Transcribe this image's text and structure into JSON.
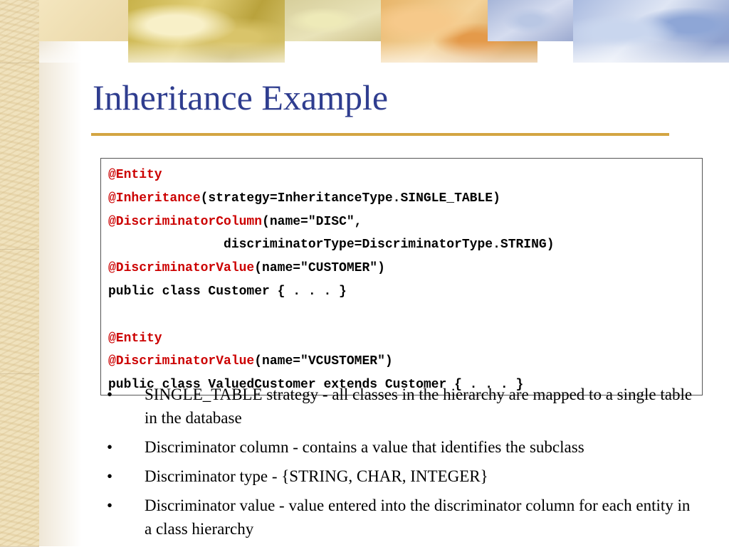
{
  "slide": {
    "title": "Inheritance Example",
    "code_lines": [
      {
        "ann": "@Entity",
        "rest": ""
      },
      {
        "ann": "@Inheritance",
        "rest": "(strategy=InheritanceType.SINGLE_TABLE)"
      },
      {
        "ann": "@DiscriminatorColumn",
        "rest": "(name=\"DISC\","
      },
      {
        "ann": "",
        "rest": "               discriminatorType=DiscriminatorType.STRING)"
      },
      {
        "ann": "@DiscriminatorValue",
        "rest": "(name=\"CUSTOMER\")"
      },
      {
        "ann": "",
        "rest": "public class Customer { . . . }"
      },
      {
        "ann": "",
        "rest": ""
      },
      {
        "ann": "@Entity",
        "rest": ""
      },
      {
        "ann": "@DiscriminatorValue",
        "rest": "(name=\"VCUSTOMER\")"
      },
      {
        "ann": "",
        "rest": "public class ValuedCustomer extends Customer { . . . }"
      }
    ],
    "bullet_char": "•",
    "bullets": [
      "SINGLE_TABLE strategy - all classes in the hierarchy are mapped to a single table in the database",
      "Discriminator column - contains a value that identifies the subclass",
      "Discriminator type - {STRING, CHAR, INTEGER}",
      "Discriminator value - value entered into the discriminator column for each entity in a class hierarchy"
    ]
  },
  "colors": {
    "title": "#2f3d8f",
    "rule": "#d3a542",
    "annotation": "#cc0000"
  }
}
